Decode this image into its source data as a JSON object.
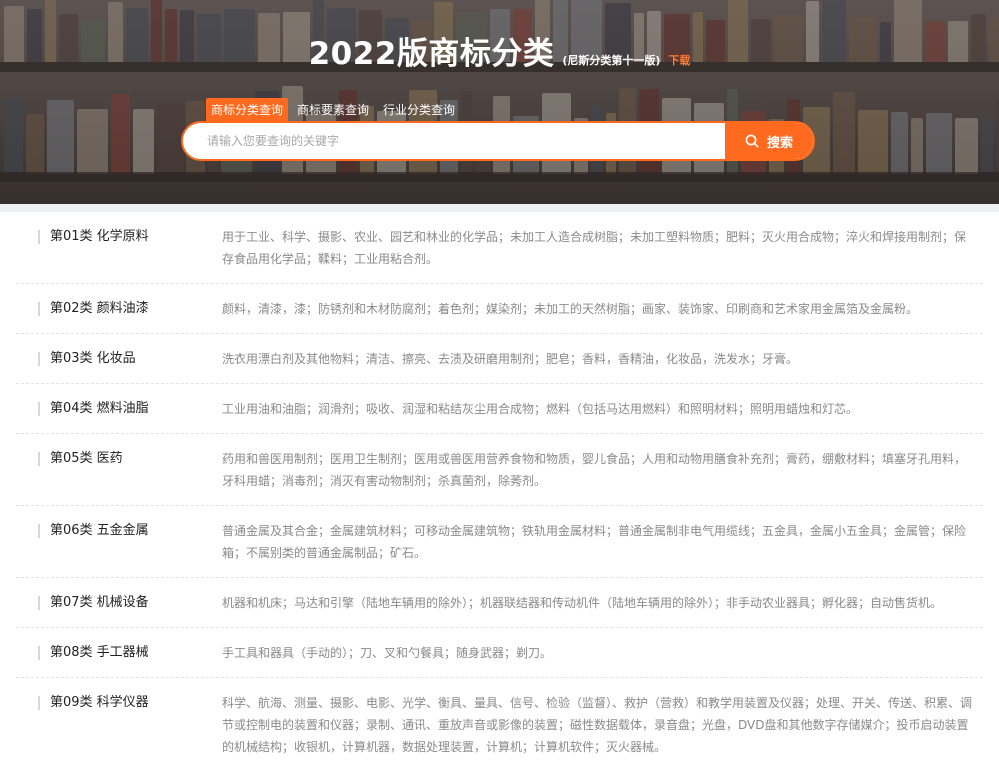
{
  "hero": {
    "title": "2022版商标分类",
    "subtitle": "(尼斯分类第十一版)",
    "download": "下载"
  },
  "tabs": [
    {
      "label": "商标分类查询",
      "active": true
    },
    {
      "label": "商标要素查询",
      "active": false
    },
    {
      "label": "行业分类查询",
      "active": false
    }
  ],
  "search": {
    "placeholder": "请输入您要查询的关键字",
    "button_label": "搜索",
    "icon": "search-icon"
  },
  "colors": {
    "accent": "#ff6a1f",
    "download": "#ff7a32",
    "desc_text": "#8a8a8a"
  },
  "categories": [
    {
      "title": "第01类 化学原料",
      "desc": "用于工业、科学、摄影、农业、园艺和林业的化学品；未加工人造合成树脂；未加工塑料物质；肥料；灭火用合成物；淬火和焊接用制剂；保存食品用化学品；鞣料；工业用粘合剂。"
    },
    {
      "title": "第02类 颜料油漆",
      "desc": "颜料，清漆，漆；防锈剂和木材防腐剂；着色剂；媒染剂；未加工的天然树脂；画家、装饰家、印刷商和艺术家用金属箔及金属粉。"
    },
    {
      "title": "第03类 化妆品",
      "desc": "洗衣用漂白剂及其他物料；清洁、擦亮、去渍及研磨用制剂；肥皂；香料，香精油，化妆品，洗发水；牙膏。"
    },
    {
      "title": "第04类 燃料油脂",
      "desc": "工业用油和油脂；润滑剂；吸收、润湿和粘结灰尘用合成物；燃料（包括马达用燃料）和照明材料；照明用蜡烛和灯芯。"
    },
    {
      "title": "第05类 医药",
      "desc": "药用和兽医用制剂；医用卫生制剂；医用或兽医用营养食物和物质，婴儿食品；人用和动物用膳食补充剂；膏药，绷敷材料；填塞牙孔用料，牙科用蜡；消毒剂；消灭有害动物制剂；杀真菌剂，除莠剂。"
    },
    {
      "title": "第06类 五金金属",
      "desc": "普通金属及其合金；金属建筑材料；可移动金属建筑物；铁轨用金属材料；普通金属制非电气用缆线；五金具，金属小五金具；金属管；保险箱；不属别类的普通金属制品；矿石。"
    },
    {
      "title": "第07类 机械设备",
      "desc": "机器和机床；马达和引擎（陆地车辆用的除外）；机器联结器和传动机件（陆地车辆用的除外）；非手动农业器具；孵化器；自动售货机。"
    },
    {
      "title": "第08类 手工器械",
      "desc": "手工具和器具（手动的）；刀、叉和勺餐具；随身武器；剃刀。"
    },
    {
      "title": "第09类 科学仪器",
      "desc": "科学、航海、测量、摄影、电影、光学、衡具、量具、信号、检验（监督）、救护（营救）和教学用装置及仪器；处理、开关、传送、积累、调节或控制电的装置和仪器；录制、通讯、重放声音或影像的装置；磁性数据载体，录音盘；光盘，DVD盘和其他数字存储媒介；投币启动装置的机械结构；收银机，计算机器，数据处理装置，计算机；计算机软件；灭火器械。"
    }
  ]
}
